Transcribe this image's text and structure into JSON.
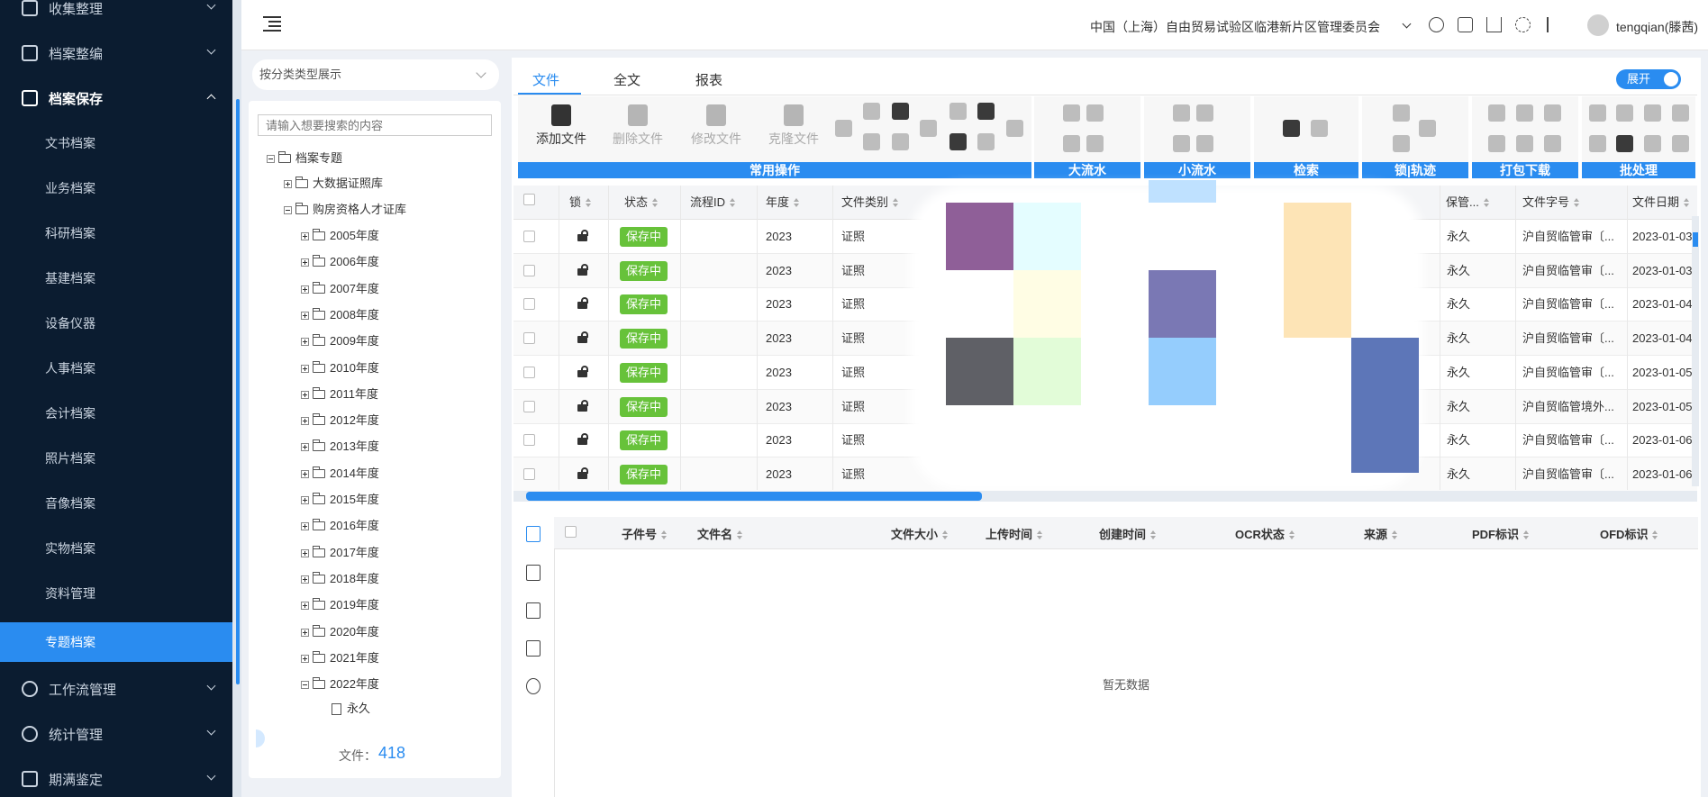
{
  "sidebar": {
    "top_items": [
      {
        "label": "收集整理"
      },
      {
        "label": "档案整编"
      },
      {
        "label": "档案保存"
      }
    ],
    "sub_items": [
      {
        "label": "文书档案"
      },
      {
        "label": "业务档案"
      },
      {
        "label": "科研档案"
      },
      {
        "label": "基建档案"
      },
      {
        "label": "设备仪器"
      },
      {
        "label": "人事档案"
      },
      {
        "label": "会计档案"
      },
      {
        "label": "照片档案"
      },
      {
        "label": "音像档案"
      },
      {
        "label": "实物档案"
      },
      {
        "label": "资料管理"
      },
      {
        "label": "专题档案"
      }
    ],
    "bottom_items": [
      {
        "label": "工作流管理"
      },
      {
        "label": "统计管理"
      },
      {
        "label": "期满鉴定"
      }
    ],
    "active": "专题档案"
  },
  "header": {
    "org": "中国（上海）自由贸易试验区临港新片区管理委员会",
    "user": "tengqian(滕茜)"
  },
  "tree": {
    "category_select": "按分类类型展示",
    "search_placeholder": "请输入想要搜索的内容",
    "root": "档案专题",
    "level1": [
      "大数据证照库",
      "购房资格人才证库"
    ],
    "years": [
      "2005年度",
      "2006年度",
      "2007年度",
      "2008年度",
      "2009年度",
      "2010年度",
      "2011年度",
      "2012年度",
      "2013年度",
      "2014年度",
      "2015年度",
      "2016年度",
      "2017年度",
      "2018年度",
      "2019年度",
      "2020年度",
      "2021年度",
      "2022年度"
    ],
    "leaf": "永久",
    "file_count_label": "文件：",
    "file_count": "418"
  },
  "tabs": [
    "文件",
    "全文",
    "报表"
  ],
  "toggle_label": "展开",
  "toolbar": {
    "buttons": [
      "添加文件",
      "删除文件",
      "修改文件",
      "克隆文件"
    ],
    "groups": [
      "常用操作",
      "大流水",
      "小流水",
      "检索",
      "锁|轨迹",
      "打包下载",
      "批处理"
    ]
  },
  "table": {
    "columns": [
      "锁",
      "状态",
      "流程ID",
      "年度",
      "文件类别",
      "保管...",
      "文件字号",
      "文件日期"
    ],
    "rows": [
      {
        "status": "保存中",
        "year": "2023",
        "category": "证照",
        "retention": "永久",
        "doc_no": "沪自贸临管审〔...",
        "date": "2023-01-03"
      },
      {
        "status": "保存中",
        "year": "2023",
        "category": "证照",
        "retention": "永久",
        "doc_no": "沪自贸临管审〔...",
        "date": "2023-01-03"
      },
      {
        "status": "保存中",
        "year": "2023",
        "category": "证照",
        "retention": "永久",
        "doc_no": "沪自贸临管审〔...",
        "date": "2023-01-04"
      },
      {
        "status": "保存中",
        "year": "2023",
        "category": "证照",
        "retention": "永久",
        "doc_no": "沪自贸临管审〔...",
        "date": "2023-01-04"
      },
      {
        "status": "保存中",
        "year": "2023",
        "category": "证照",
        "retention": "永久",
        "doc_no": "沪自贸临管审〔...",
        "date": "2023-01-05"
      },
      {
        "status": "保存中",
        "year": "2023",
        "category": "证照",
        "retention": "永久",
        "doc_no": "沪自贸临管境外...",
        "date": "2023-01-05"
      },
      {
        "status": "保存中",
        "year": "2023",
        "category": "证照",
        "retention": "永久",
        "doc_no": "沪自贸临管审〔...",
        "date": "2023-01-06"
      },
      {
        "status": "保存中",
        "year": "2023",
        "category": "证照",
        "retention": "永久",
        "doc_no": "沪自贸临管审〔...",
        "date": "2023-01-06"
      }
    ]
  },
  "subtable": {
    "columns": [
      "子件号",
      "文件名",
      "文件大小",
      "上传时间",
      "创建时间",
      "OCR状态",
      "来源",
      "PDF标识",
      "OFD标识"
    ],
    "empty_text": "暂无数据"
  },
  "colors": {
    "sidebar_bg": "#0b1c30",
    "accent": "#2a8cf0",
    "status_green": "#67c23a"
  }
}
